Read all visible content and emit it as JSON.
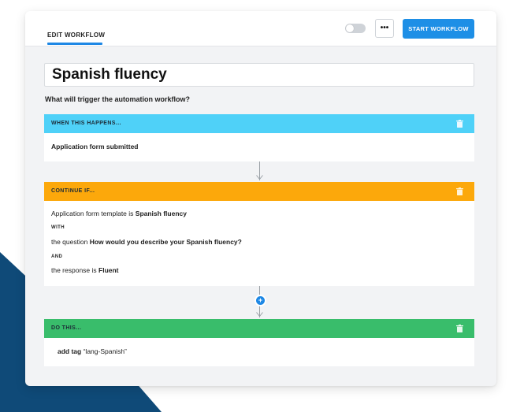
{
  "header": {
    "tab_label": "EDIT WORKFLOW",
    "more_label": "•••",
    "start_label": "START WORKFLOW"
  },
  "workflow": {
    "title": "Spanish fluency",
    "trigger_question": "What will trigger the automation workflow?"
  },
  "when": {
    "header": "WHEN THIS HAPPENS...",
    "event": "Application form submitted"
  },
  "continue_if": {
    "header": "CONTINUE IF...",
    "line1_prefix": "Application form template is ",
    "line1_value": "Spanish fluency",
    "with_label": "WITH",
    "line2_prefix": "the question ",
    "line2_value": "How would you describe your Spanish fluency?",
    "and_label": "AND",
    "line3_prefix": "the response is ",
    "line3_value": "Fluent"
  },
  "do_this": {
    "header": "DO THIS...",
    "action": "add tag",
    "action_value": " “lang-Spanish”"
  },
  "colors": {
    "when": "#4fd1f8",
    "continue": "#fca80b",
    "do": "#39bd6b",
    "accent": "#1e88e5",
    "bg_shape": "#0f4a78"
  },
  "icons": [
    "trash-icon",
    "add-step-icon",
    "arrow-down-icon",
    "toggle-switch"
  ]
}
